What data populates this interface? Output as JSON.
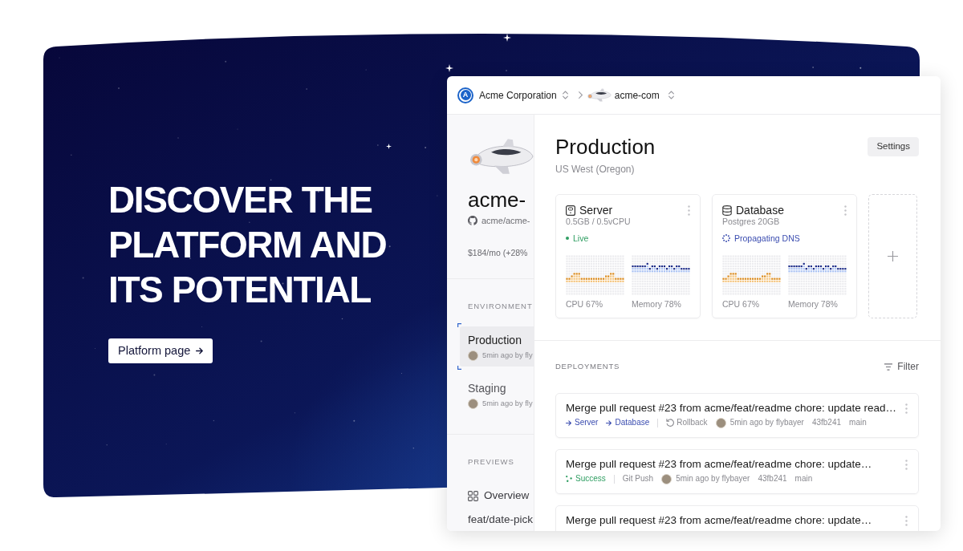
{
  "banner": {
    "headline": "DISCOVER THE PLATFORM AND ITS POTENTIAL",
    "button": "Platform page"
  },
  "top_bar": {
    "org": {
      "logo_letter": "A",
      "name": "Acme Corporation"
    },
    "project": "acme-com"
  },
  "sidebar": {
    "project_name": "acme-",
    "repo": "acme/acme-",
    "cost": "$184/mo (+28%",
    "environments_label": "ENVIRONMENT",
    "environments": [
      {
        "name": "Production",
        "meta": "5min ago by fly",
        "selected": true
      },
      {
        "name": "Staging",
        "meta": "5min ago by fly",
        "selected": false
      }
    ],
    "previews_label": "PREVIEWS",
    "previews": [
      {
        "kind": "overview",
        "label": "Overview"
      },
      {
        "kind": "branch",
        "label": "feat/date-pick"
      }
    ]
  },
  "environment": {
    "title": "Production",
    "region": "US West (Oregon)",
    "settings_button": "Settings",
    "services": [
      {
        "kind": "server",
        "name": "Server",
        "spec": "0.5GB / 0.5vCPU",
        "status": {
          "kind": "live",
          "label": "Live"
        },
        "metrics": [
          {
            "kind": "cpu",
            "label": "CPU 67%"
          },
          {
            "kind": "memory",
            "label": "Memory 78%"
          }
        ]
      },
      {
        "kind": "database",
        "name": "Database",
        "spec": "Postgres 20GB",
        "status": {
          "kind": "propagating",
          "label": "Propagating DNS"
        },
        "metrics": [
          {
            "kind": "cpu",
            "label": "CPU 67%"
          },
          {
            "kind": "memory",
            "label": "Memory 78%"
          }
        ]
      }
    ]
  },
  "deployments": {
    "label": "DEPLOYMENTS",
    "filter_button": "Filter",
    "items": [
      {
        "title": "Merge pull request #23 from acme/feat/readme chore: update read…",
        "tags": [
          {
            "kind": "target",
            "label": "Server"
          },
          {
            "kind": "target",
            "label": "Database"
          }
        ],
        "trigger": {
          "kind": "rollback",
          "label": "Rollback"
        },
        "author": "5min ago by flybayer",
        "commit": "43fb241",
        "branch": "main"
      },
      {
        "title": "Merge pull request #23 from acme/feat/readme chore: update…",
        "tags": [
          {
            "kind": "success",
            "label": "Success"
          }
        ],
        "trigger": {
          "kind": "push",
          "label": "Git Push"
        },
        "author": "5min ago by flybayer",
        "commit": "43fb241",
        "branch": "main"
      },
      {
        "title": "Merge pull request #23 from acme/feat/readme chore: update…"
      }
    ]
  }
}
